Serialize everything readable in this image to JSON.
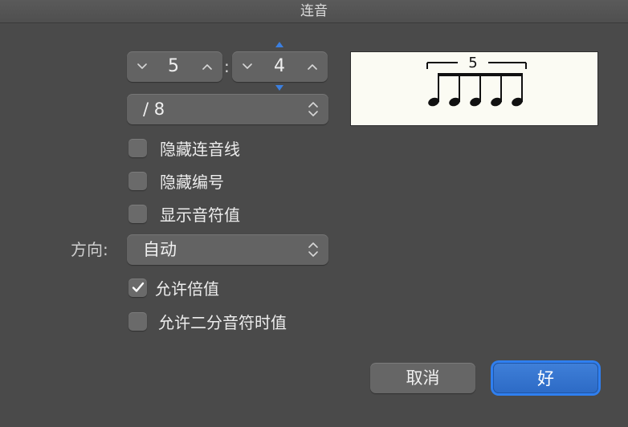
{
  "window": {
    "title": "连音"
  },
  "tuplet": {
    "count": "5",
    "in_time_of": "4",
    "colon": ":",
    "note_value": "/ 8"
  },
  "checkboxes": [
    {
      "label": "隐藏连音线",
      "checked": false
    },
    {
      "label": "隐藏编号",
      "checked": false
    },
    {
      "label": "显示音符值",
      "checked": false
    },
    {
      "label": "允许倍值",
      "checked": true
    },
    {
      "label": "允许二分音符时值",
      "checked": false
    }
  ],
  "direction": {
    "label": "方向:",
    "value": "自动"
  },
  "preview": {
    "number": "5"
  },
  "buttons": {
    "cancel": "取消",
    "ok": "好"
  },
  "colors": {
    "accent": "#2f7ff0",
    "background": "#4a4a4a",
    "preview_bg": "#fbfbf3"
  }
}
